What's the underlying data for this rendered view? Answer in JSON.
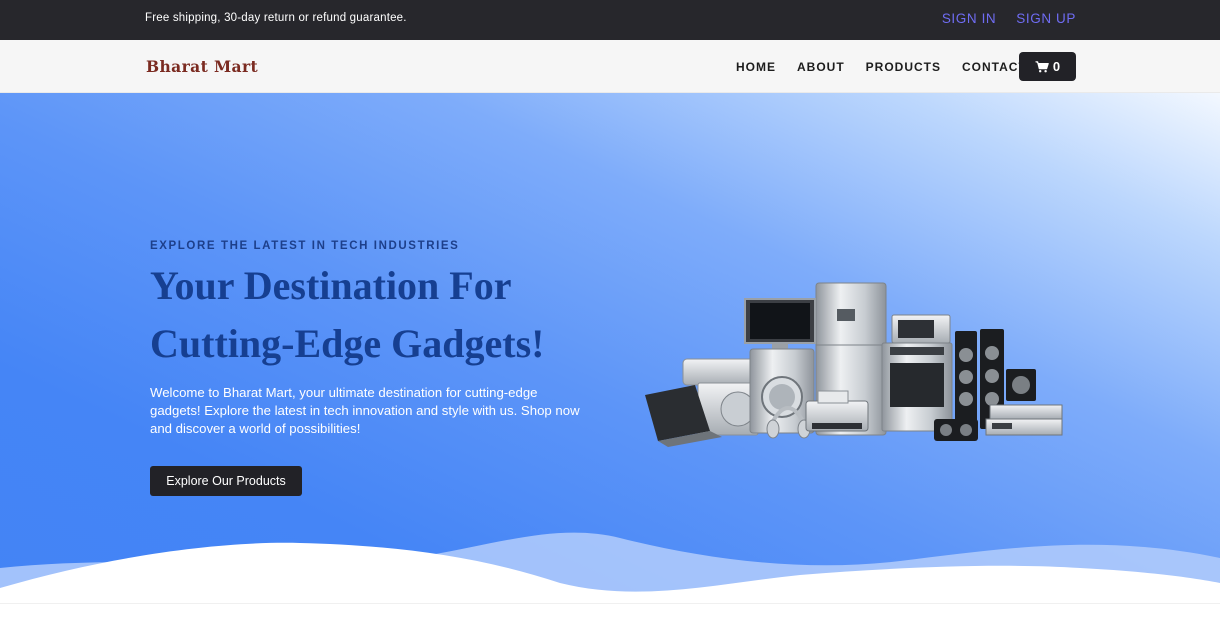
{
  "topbar": {
    "promo": "Free shipping, 30-day return or refund guarantee.",
    "sign_in": "SIGN IN",
    "sign_up": "SIGN UP"
  },
  "navbar": {
    "brand": "Bharat Mart",
    "links": [
      "HOME",
      "ABOUT",
      "PRODUCTS",
      "CONTACT"
    ],
    "cart_count": "0",
    "cart_icon": "shopping-cart-icon"
  },
  "hero": {
    "kicker": "EXPLORE THE LATEST IN TECH INDUSTRIES",
    "title_line1": "Your Destination For",
    "title_line2": "Cutting-Edge Gadgets!",
    "lead": "Welcome to Bharat Mart, your ultimate destination for cutting-edge gadgets! Explore the latest in tech innovation and style with us. Shop now and discover a world of possibilities!",
    "cta": "Explore Our Products"
  },
  "colors": {
    "topbar_bg": "#27272c",
    "auth_link": "#6f6cf3",
    "brand": "#7b2b21",
    "hero_title": "#163f91",
    "hero_blue": "#4384f5",
    "button_dark": "#222227"
  }
}
